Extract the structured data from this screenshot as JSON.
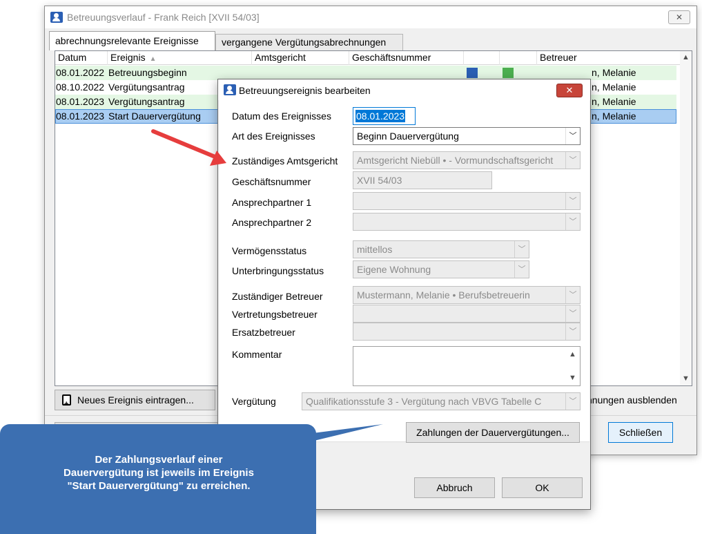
{
  "main_window": {
    "title": "Betreuungsverlauf - Frank Reich [XVII 54/03]",
    "close_glyph": "✕",
    "tabs": [
      {
        "label": "abrechnungsrelevante Ereignisse"
      },
      {
        "label": "vergangene Vergütungsabrechnungen"
      }
    ],
    "columns": [
      "Datum",
      "Ereignis",
      "Amtsgericht",
      "Geschäftsnummer",
      "",
      "",
      "Betreuer"
    ],
    "rows": [
      {
        "date": "08.01.2022",
        "event": "Betreuungsbeginn",
        "betreuer": "n, Melanie"
      },
      {
        "date": "08.10.2022",
        "event": "Vergütungsantrag",
        "betreuer": "n, Melanie"
      },
      {
        "date": "08.01.2023",
        "event": "Vergütungsantrag",
        "betreuer": "n, Melanie"
      },
      {
        "date": "08.01.2023",
        "event": "Start Dauervergütung",
        "betreuer": "n, Melanie"
      }
    ],
    "new_event_label": "Neues Ereignis eintragen...",
    "hide_label": "hnungen ausblenden",
    "close_label": "Schließen"
  },
  "dialog": {
    "title": "Betreuungsereignis bearbeiten",
    "close_glyph": "✕",
    "fields": {
      "datum_label": "Datum des Ereignisses",
      "datum_value": "08.01.2023",
      "art_label": "Art des Ereignisses",
      "art_value": "Beginn Dauervergütung",
      "amtsgericht_label": "Zuständiges Amtsgericht",
      "amtsgericht_value": "Amtsgericht Niebüll • - Vormundschaftsgericht",
      "geschaeftsnummer_label": "Geschäftsnummer",
      "geschaeftsnummer_value": "XVII 54/03",
      "ansprechpartner1_label": "Ansprechpartner 1",
      "ansprechpartner2_label": "Ansprechpartner 2",
      "vermoegen_label": "Vermögensstatus",
      "vermoegen_value": "mittellos",
      "unterbringung_label": "Unterbringungsstatus",
      "unterbringung_value": "Eigene Wohnung",
      "betreuer_label": "Zuständiger Betreuer",
      "betreuer_value": "Mustermann, Melanie • Berufsbetreuerin",
      "vertretung_label": "Vertretungsbetreuer",
      "ersatz_label": "Ersatzbetreuer",
      "kommentar_label": "Kommentar",
      "verguetung_label": "Vergütung",
      "verguetung_value": "Qualifikationsstufe 3 - Vergütung nach VBVG Tabelle C"
    },
    "zahlungen_button": "Zahlungen der Dauervergütungen...",
    "cancel_button": "Abbruch",
    "ok_button": "OK"
  },
  "callout": {
    "line1": "Der Zahlungsverlauf einer",
    "line2": "Dauervergütung ist jeweils im Ereignis",
    "line3": "\"Start Dauervergütung\" zu erreichen."
  },
  "colors": {
    "selected_row": "#a9cdf2",
    "green_row": "#e4f7e4",
    "callout": "#3c6fb1",
    "arrow": "#e63d3d"
  }
}
